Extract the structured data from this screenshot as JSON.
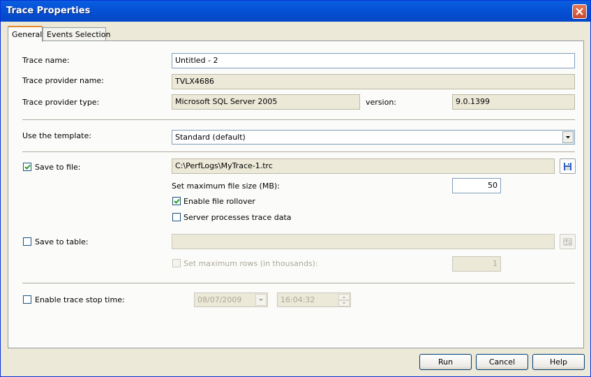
{
  "window": {
    "title": "Trace Properties"
  },
  "tabs": [
    {
      "label": "General"
    },
    {
      "label": "Events Selection"
    }
  ],
  "general": {
    "trace_name": {
      "label": "Trace name:",
      "value": "Untitled - 2"
    },
    "provider_name": {
      "label": "Trace provider name:",
      "value": "TVLX4686"
    },
    "provider_type": {
      "label": "Trace provider type:",
      "value": "Microsoft SQL Server 2005"
    },
    "version": {
      "label": "version:",
      "value": "9.0.1399"
    },
    "template": {
      "label": "Use the template:",
      "value": "Standard (default)"
    },
    "save_to_file": {
      "label": "Save to file:",
      "checked": true,
      "path": "C:\\PerfLogs\\MyTrace-1.trc",
      "max_size_label": "Set maximum file size (MB):",
      "max_size_value": "50",
      "rollover_label": "Enable file rollover",
      "rollover_checked": true,
      "server_processes_label": "Server processes trace data",
      "server_processes_checked": false
    },
    "save_to_table": {
      "label": "Save to table:",
      "checked": false,
      "value": "",
      "max_rows_label": "Set maximum rows (in thousands):",
      "max_rows_value": "1"
    },
    "stop_time": {
      "label": "Enable trace stop time:",
      "checked": false,
      "date": "08/07/2009",
      "time": "16:04:32"
    }
  },
  "buttons": {
    "run": "Run",
    "cancel": "Cancel",
    "help": "Help"
  },
  "colors": {
    "titlebar": "#0652d6",
    "tab_accent": "#e68b2c",
    "background": "#ece9d8"
  }
}
